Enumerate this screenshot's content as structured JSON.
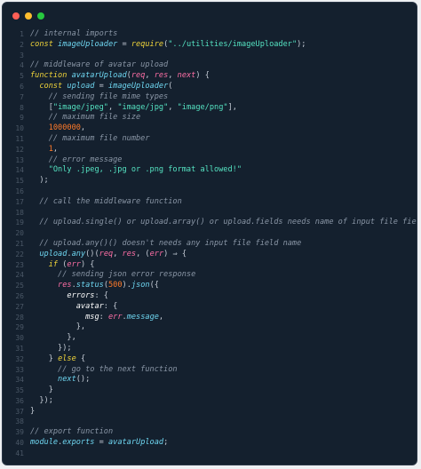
{
  "window": {
    "controls": [
      "close",
      "minimize",
      "maximize"
    ]
  },
  "colors": {
    "background": "#14202e",
    "close": "#ff5f56",
    "minimize": "#ffbd2e",
    "maximize": "#27c93f",
    "comment": "#8a96a6",
    "keyword": "#f0d43a",
    "plain": "#e6e9ee",
    "fn": "#6fd7f2",
    "string": "#55e3c2",
    "number": "#ff7a29",
    "param": "#ff6fa6",
    "prop": "#ffffff",
    "punct": "#c5ccd6"
  },
  "code": {
    "lines": [
      {
        "n": "1",
        "tokens": [
          [
            "comment",
            "// internal imports"
          ]
        ]
      },
      {
        "n": "2",
        "tokens": [
          [
            "keyword",
            "const "
          ],
          [
            "fn",
            "imageUploader"
          ],
          [
            "punct",
            " = "
          ],
          [
            "keyword",
            "require"
          ],
          [
            "punct",
            "("
          ],
          [
            "string",
            "\"../utilities/imageUploader\""
          ],
          [
            "punct",
            ");"
          ]
        ]
      },
      {
        "n": "3",
        "tokens": []
      },
      {
        "n": "4",
        "tokens": [
          [
            "comment",
            "// middleware of avatar upload"
          ]
        ]
      },
      {
        "n": "5",
        "tokens": [
          [
            "keyword",
            "function "
          ],
          [
            "fn",
            "avatarUpload"
          ],
          [
            "punct",
            "("
          ],
          [
            "param",
            "req"
          ],
          [
            "punct",
            ", "
          ],
          [
            "param",
            "res"
          ],
          [
            "punct",
            ", "
          ],
          [
            "param",
            "next"
          ],
          [
            "punct",
            ") {"
          ]
        ]
      },
      {
        "n": "6",
        "tokens": [
          [
            "plain",
            "  "
          ],
          [
            "keyword",
            "const "
          ],
          [
            "fn",
            "upload"
          ],
          [
            "punct",
            " = "
          ],
          [
            "fn",
            "imageUploader"
          ],
          [
            "punct",
            "("
          ]
        ]
      },
      {
        "n": "7",
        "tokens": [
          [
            "plain",
            "    "
          ],
          [
            "comment",
            "// sending file mime types"
          ]
        ]
      },
      {
        "n": "8",
        "tokens": [
          [
            "plain",
            "    "
          ],
          [
            "punct",
            "["
          ],
          [
            "string",
            "\"image/jpeg\""
          ],
          [
            "punct",
            ", "
          ],
          [
            "string",
            "\"image/jpg\""
          ],
          [
            "punct",
            ", "
          ],
          [
            "string",
            "\"image/png\""
          ],
          [
            "punct",
            "],"
          ]
        ]
      },
      {
        "n": "9",
        "tokens": [
          [
            "plain",
            "    "
          ],
          [
            "comment",
            "// maximum file size"
          ]
        ]
      },
      {
        "n": "10",
        "tokens": [
          [
            "plain",
            "    "
          ],
          [
            "number",
            "1000000"
          ],
          [
            "punct",
            ","
          ]
        ]
      },
      {
        "n": "11",
        "tokens": [
          [
            "plain",
            "    "
          ],
          [
            "comment",
            "// maximum file number"
          ]
        ]
      },
      {
        "n": "12",
        "tokens": [
          [
            "plain",
            "    "
          ],
          [
            "number",
            "1"
          ],
          [
            "punct",
            ","
          ]
        ]
      },
      {
        "n": "13",
        "tokens": [
          [
            "plain",
            "    "
          ],
          [
            "comment",
            "// error message"
          ]
        ]
      },
      {
        "n": "14",
        "tokens": [
          [
            "plain",
            "    "
          ],
          [
            "string",
            "\"Only .jpeg, .jpg or .png format allowed!\""
          ]
        ]
      },
      {
        "n": "15",
        "tokens": [
          [
            "plain",
            "  "
          ],
          [
            "punct",
            ");"
          ]
        ]
      },
      {
        "n": "16",
        "tokens": []
      },
      {
        "n": "17",
        "tokens": [
          [
            "plain",
            "  "
          ],
          [
            "comment",
            "// call the middleware function"
          ]
        ]
      },
      {
        "n": "18",
        "tokens": []
      },
      {
        "n": "19",
        "tokens": [
          [
            "plain",
            "  "
          ],
          [
            "comment",
            "// upload.single() or upload.array() or upload.fields needs name of input file field"
          ]
        ]
      },
      {
        "n": "20",
        "tokens": []
      },
      {
        "n": "21",
        "tokens": [
          [
            "plain",
            "  "
          ],
          [
            "comment",
            "// upload.any()() doesn't needs any input file field name"
          ]
        ]
      },
      {
        "n": "22",
        "tokens": [
          [
            "plain",
            "  "
          ],
          [
            "fn",
            "upload"
          ],
          [
            "punct",
            "."
          ],
          [
            "fn",
            "any"
          ],
          [
            "punct",
            "()("
          ],
          [
            "param",
            "req"
          ],
          [
            "punct",
            ", "
          ],
          [
            "param",
            "res"
          ],
          [
            "punct",
            ", ("
          ],
          [
            "param",
            "err"
          ],
          [
            "punct",
            ") ⇒ {"
          ]
        ]
      },
      {
        "n": "23",
        "tokens": [
          [
            "plain",
            "    "
          ],
          [
            "keyword",
            "if "
          ],
          [
            "punct",
            "("
          ],
          [
            "param",
            "err"
          ],
          [
            "punct",
            ") {"
          ]
        ]
      },
      {
        "n": "24",
        "tokens": [
          [
            "plain",
            "      "
          ],
          [
            "comment",
            "// sending json error response"
          ]
        ]
      },
      {
        "n": "25",
        "tokens": [
          [
            "plain",
            "      "
          ],
          [
            "param",
            "res"
          ],
          [
            "punct",
            "."
          ],
          [
            "fn",
            "status"
          ],
          [
            "punct",
            "("
          ],
          [
            "number",
            "500"
          ],
          [
            "punct",
            ")."
          ],
          [
            "fn",
            "json"
          ],
          [
            "punct",
            "({"
          ]
        ]
      },
      {
        "n": "26",
        "tokens": [
          [
            "plain",
            "        "
          ],
          [
            "prop",
            "errors"
          ],
          [
            "punct",
            ": {"
          ]
        ]
      },
      {
        "n": "27",
        "tokens": [
          [
            "plain",
            "          "
          ],
          [
            "prop",
            "avatar"
          ],
          [
            "punct",
            ": {"
          ]
        ]
      },
      {
        "n": "28",
        "tokens": [
          [
            "plain",
            "            "
          ],
          [
            "prop",
            "msg"
          ],
          [
            "punct",
            ": "
          ],
          [
            "param",
            "err"
          ],
          [
            "punct",
            "."
          ],
          [
            "fn",
            "message"
          ],
          [
            "punct",
            ","
          ]
        ]
      },
      {
        "n": "29",
        "tokens": [
          [
            "plain",
            "          "
          ],
          [
            "punct",
            "},"
          ]
        ]
      },
      {
        "n": "30",
        "tokens": [
          [
            "plain",
            "        "
          ],
          [
            "punct",
            "},"
          ]
        ]
      },
      {
        "n": "31",
        "tokens": [
          [
            "plain",
            "      "
          ],
          [
            "punct",
            "});"
          ]
        ]
      },
      {
        "n": "32",
        "tokens": [
          [
            "plain",
            "    "
          ],
          [
            "punct",
            "} "
          ],
          [
            "keyword",
            "else "
          ],
          [
            "punct",
            "{"
          ]
        ]
      },
      {
        "n": "33",
        "tokens": [
          [
            "plain",
            "      "
          ],
          [
            "comment",
            "// go to the next function"
          ]
        ]
      },
      {
        "n": "34",
        "tokens": [
          [
            "plain",
            "      "
          ],
          [
            "fn",
            "next"
          ],
          [
            "punct",
            "();"
          ]
        ]
      },
      {
        "n": "35",
        "tokens": [
          [
            "plain",
            "    "
          ],
          [
            "punct",
            "}"
          ]
        ]
      },
      {
        "n": "36",
        "tokens": [
          [
            "plain",
            "  "
          ],
          [
            "punct",
            "});"
          ]
        ]
      },
      {
        "n": "37",
        "tokens": [
          [
            "punct",
            "}"
          ]
        ]
      },
      {
        "n": "38",
        "tokens": []
      },
      {
        "n": "39",
        "tokens": [
          [
            "comment",
            "// export function"
          ]
        ]
      },
      {
        "n": "40",
        "tokens": [
          [
            "fn",
            "module"
          ],
          [
            "punct",
            "."
          ],
          [
            "fn",
            "exports"
          ],
          [
            "punct",
            " = "
          ],
          [
            "fn",
            "avatarUpload"
          ],
          [
            "punct",
            ";"
          ]
        ]
      },
      {
        "n": "41",
        "tokens": []
      }
    ]
  }
}
